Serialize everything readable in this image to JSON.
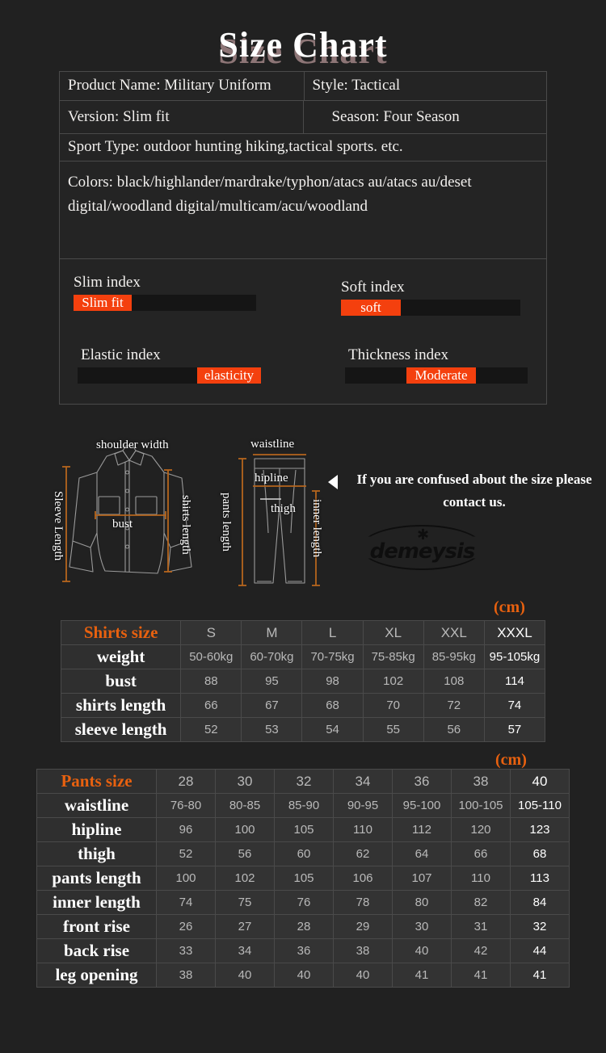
{
  "title": "Size Chart",
  "info": {
    "product_name": "Product Name: Military Uniform",
    "style": "Style: Tactical",
    "version": "Version: Slim fit",
    "season": "Season: Four Season",
    "sport_type": "Sport Type: outdoor hunting hiking,tactical sports. etc.",
    "colors": "Colors: black/highlander/mardrake/typhon/atacs au/atacs au/deset digital/woodland digital/multicam/acu/woodland"
  },
  "indices": {
    "accent_color": "#f4400e",
    "slim": {
      "label": "Slim index",
      "value": "Slim fit"
    },
    "soft": {
      "label": "Soft index",
      "value": "soft"
    },
    "elastic": {
      "label": "Elastic index",
      "value": "elasticity"
    },
    "thickness": {
      "label": "Thickness index",
      "value": "Moderate"
    }
  },
  "diagram": {
    "shoulder_width": "shoulder width",
    "sleeve_length": "Sleeve Length",
    "bust": "bust",
    "shirts_length": "shirts length",
    "waistline": "waistline",
    "hipline": "hipline",
    "thigh": "thigh",
    "pants_length": "pants length",
    "inner_length": "inner length",
    "contact_note": "If you are confused about the size please contact us.",
    "watermark": "demeysis"
  },
  "chart_data": [
    {
      "type": "table",
      "title": "Shirts size",
      "unit": "(cm)",
      "categories": [
        "S",
        "M",
        "L",
        "XL",
        "XXL",
        "XXXL"
      ],
      "highlight_column": "XXXL",
      "rows": [
        {
          "name": "weight",
          "values": [
            "50-60kg",
            "60-70kg",
            "70-75kg",
            "75-85kg",
            "85-95kg",
            "95-105kg"
          ]
        },
        {
          "name": "bust",
          "values": [
            "88",
            "95",
            "98",
            "102",
            "108",
            "114"
          ]
        },
        {
          "name": "shirts length",
          "values": [
            "66",
            "67",
            "68",
            "70",
            "72",
            "74"
          ]
        },
        {
          "name": "sleeve length",
          "values": [
            "52",
            "53",
            "54",
            "55",
            "56",
            "57"
          ]
        }
      ]
    },
    {
      "type": "table",
      "title": "Pants size",
      "unit": "(cm)",
      "categories": [
        "28",
        "30",
        "32",
        "34",
        "36",
        "38",
        "40"
      ],
      "highlight_column": "40",
      "rows": [
        {
          "name": "waistline",
          "values": [
            "76-80",
            "80-85",
            "85-90",
            "90-95",
            "95-100",
            "100-105",
            "105-110"
          ]
        },
        {
          "name": "hipline",
          "values": [
            "96",
            "100",
            "105",
            "110",
            "112",
            "120",
            "123"
          ]
        },
        {
          "name": "thigh",
          "values": [
            "52",
            "56",
            "60",
            "62",
            "64",
            "66",
            "68"
          ]
        },
        {
          "name": "pants length",
          "values": [
            "100",
            "102",
            "105",
            "106",
            "107",
            "110",
            "113"
          ]
        },
        {
          "name": "inner length",
          "values": [
            "74",
            "75",
            "76",
            "78",
            "80",
            "82",
            "84"
          ]
        },
        {
          "name": "front rise",
          "values": [
            "26",
            "27",
            "28",
            "29",
            "30",
            "31",
            "32"
          ]
        },
        {
          "name": "back rise",
          "values": [
            "33",
            "34",
            "36",
            "38",
            "40",
            "42",
            "44"
          ]
        },
        {
          "name": "leg opening",
          "values": [
            "38",
            "40",
            "40",
            "40",
            "41",
            "41",
            "41"
          ]
        }
      ]
    }
  ]
}
